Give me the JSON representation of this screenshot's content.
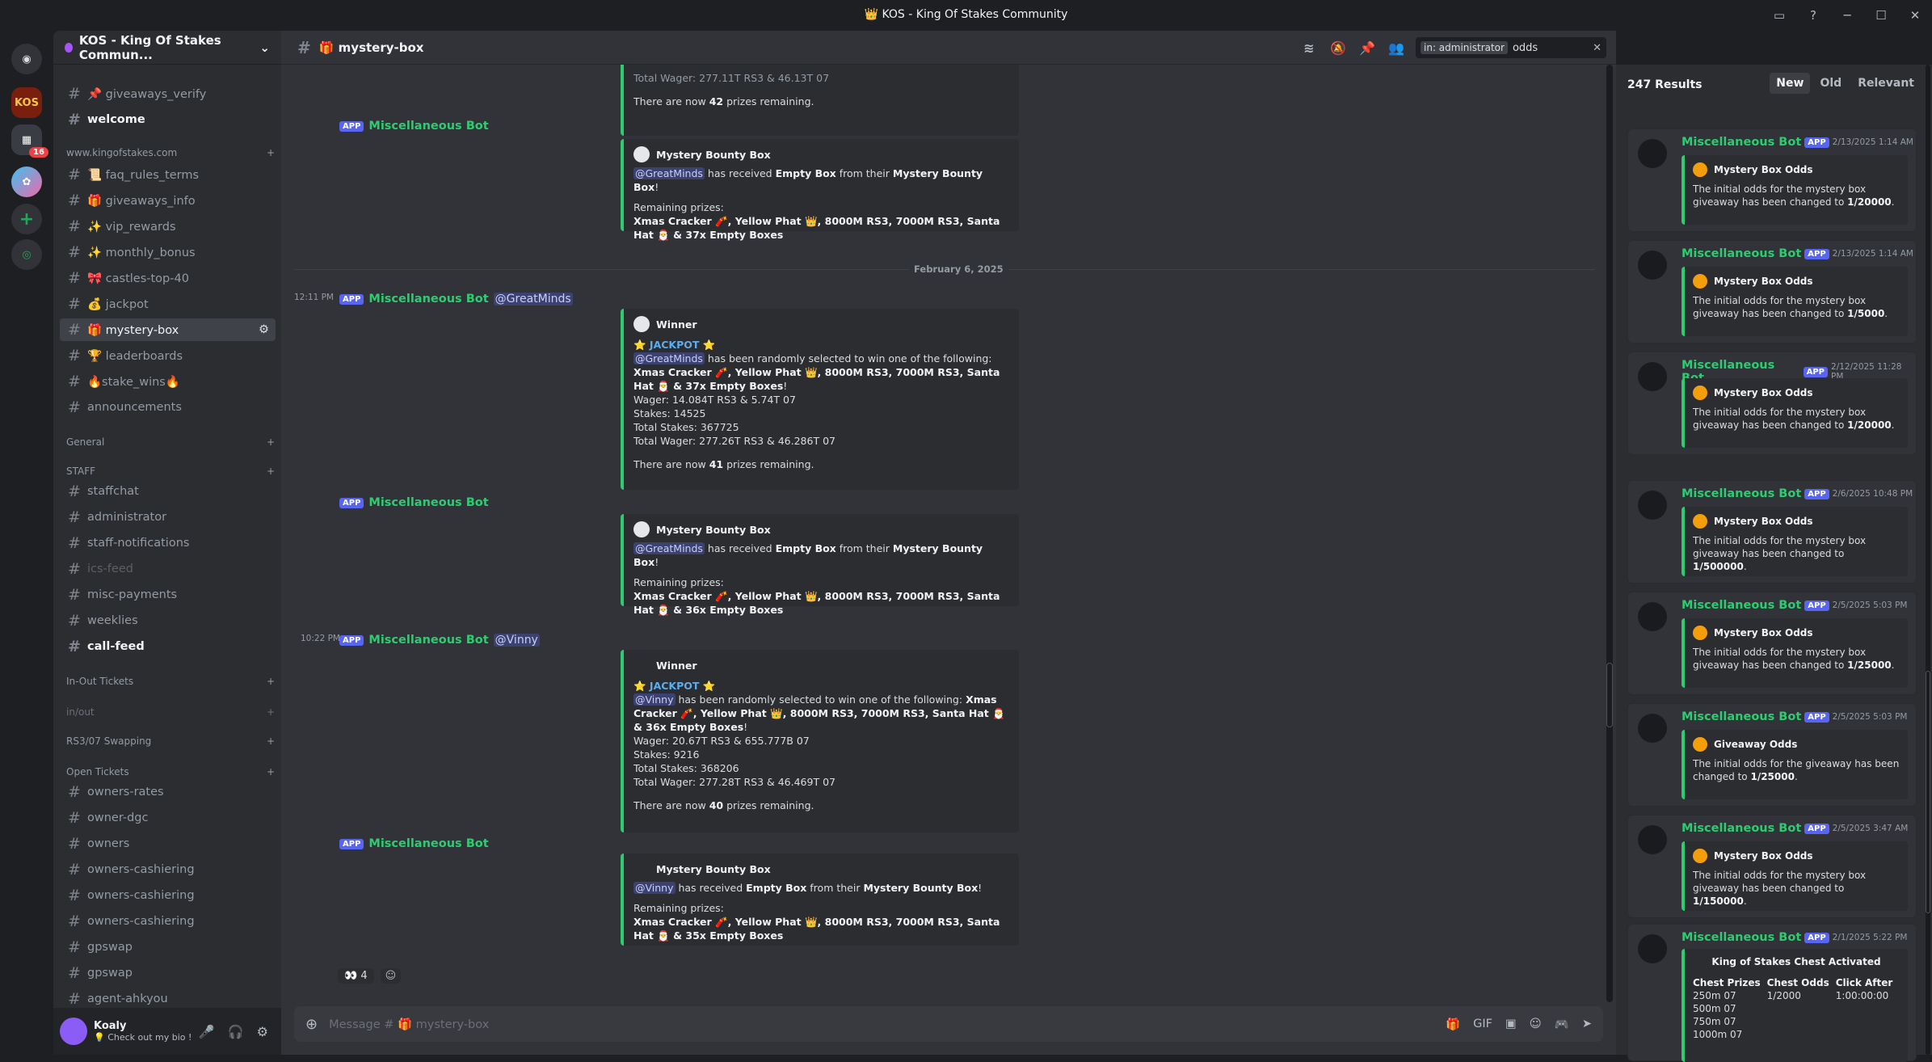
{
  "window": {
    "title": "KOS - King Of Stakes Community",
    "title_icon": "crown-emoji"
  },
  "servers": {
    "badge": "16"
  },
  "guild": {
    "name": "KOS - King Of Stakes Commun..."
  },
  "channels": [
    {
      "label": "📌 giveaways_verify",
      "state": "normal"
    },
    {
      "label": "welcome",
      "state": "unread"
    }
  ],
  "categories": {
    "site": "www.kingofstakes.com",
    "general": "General",
    "staff": "STAFF",
    "inout": "In-Out Tickets",
    "inout_channel": "in/out",
    "rs3": "RS3/07 Swapping",
    "open": "Open Tickets"
  },
  "site_channels": [
    "📜 faq_rules_terms",
    "🎁 giveaways_info",
    "✨ vip_rewards",
    "✨ monthly_bonus",
    "🎀 castles-top-40",
    "💰 jackpot",
    "🎁 mystery-box",
    "🏆 leaderboards",
    "🔥stake_wins🔥",
    "announcements"
  ],
  "staff_channels": [
    "staffchat",
    "administrator",
    "staff-notifications",
    "ics-feed",
    "misc-payments",
    "weeklies",
    "call-feed"
  ],
  "ticket_channels": [
    "owners-rates",
    "owner-dgc",
    "owners",
    "owners-cashiering",
    "owners-cashiering",
    "owners-cashiering",
    "gpswap",
    "gpswap",
    "agent-ahkyou"
  ],
  "user": {
    "name": "Koaly",
    "status": "💡 Check out my bio !"
  },
  "header": {
    "channel": "🎁 mystery-box",
    "search_filter": "in: administrator",
    "search_query": "odds"
  },
  "messages": {
    "top_partial": "Total Wager: 277.11T RS3 & 46.13T 07",
    "top_remaining_pre": "There are now ",
    "top_remaining_num": "42",
    "top_remaining_post": " prizes remaining.",
    "bot": "Miscellaneous Bot",
    "app": "APP",
    "bounty_title": "Mystery Bounty Box",
    "m1_mention": "@GreatMinds",
    "m1_text_a": " has received ",
    "m1_empty": "Empty Box",
    "m1_text_b": " from their ",
    "m1_box": "Mystery Bounty Box",
    "m1_excl": "!",
    "remaining_label": "Remaining prizes:",
    "m1_prizes": "Xmas Cracker 🧨, Yellow Phat 👑, 8000M RS3, 7000M RS3, Santa Hat 🎅 & 37x Empty Boxes",
    "date_divider": "February 6, 2025",
    "w1_time": "12:11 PM",
    "w1_mention": "@GreatMinds",
    "winner": "Winner",
    "jackpot": "⭐ JACKPOT ⭐",
    "w1_selected": " has been randomly selected to win one of the following: ",
    "w1_prizes": "Xmas Cracker 🧨, Yellow Phat 👑, 8000M RS3, 7000M RS3, Santa Hat 🎅 & 37x Empty Boxes",
    "w1_wager": "Wager: 14.084T RS3 & 5.74T 07",
    "w1_stakes": "Stakes: 14525",
    "w1_total_stakes": "Total Stakes: 367725",
    "w1_total_wager": "Total Wager: 277.26T RS3 & 46.286T 07",
    "w1_remaining": "41",
    "m2_prizes": "Xmas Cracker 🧨, Yellow Phat 👑, 8000M RS3, 7000M RS3, Santa Hat 🎅 & 36x Empty Boxes",
    "w2_time": "10:22 PM",
    "w2_mention": "@Vinny",
    "w2_prizes": "Xmas Cracker 🧨, Yellow Phat 👑, 8000M RS3, 7000M RS3, Santa Hat 🎅 & 36x Empty Boxes",
    "w2_wager": "Wager: 20.67T RS3 & 655.777B 07",
    "w2_stakes": "Stakes: 9216",
    "w2_total_stakes": "Total Stakes: 368206",
    "w2_total_wager": "Total Wager: 277.28T RS3 & 46.469T 07",
    "w2_remaining": "40",
    "m3_mention": "@Vinny",
    "m3_prizes": "Xmas Cracker 🧨, Yellow Phat 👑, 8000M RS3, 7000M RS3, Santa Hat 🎅 & 35x Empty Boxes",
    "reaction_emoji": "👀",
    "reaction_count": "4"
  },
  "composer": {
    "placeholder": "Message # 🎁 mystery-box"
  },
  "search": {
    "count": "247 Results",
    "tabs": [
      "New",
      "Old",
      "Relevant"
    ],
    "results": [
      {
        "time": "2/13/2025 1:14 AM",
        "title": "Mystery Box Odds",
        "text": "The initial odds for the mystery box giveaway has been changed to ",
        "odds": "1/20000"
      },
      {
        "time": "2/13/2025 1:14 AM",
        "title": "Mystery Box Odds",
        "text": "The initial odds for the mystery box giveaway has been changed to ",
        "odds": "1/5000"
      },
      {
        "time": "2/12/2025 11:28 PM",
        "title": "Mystery Box Odds",
        "text": "The initial odds for the mystery box giveaway has been changed to ",
        "odds": "1/20000"
      },
      {
        "time": "2/6/2025 10:48 PM",
        "title": "Mystery Box Odds",
        "text": "The initial odds for the mystery box giveaway has been changed to ",
        "odds": "1/500000"
      },
      {
        "time": "2/5/2025 5:03 PM",
        "title": "Mystery Box Odds",
        "text": "The initial odds for the mystery box giveaway has been changed to ",
        "odds": "1/25000"
      },
      {
        "time": "2/5/2025 5:03 PM",
        "title": "Giveaway Odds",
        "text": "The initial odds for the giveaway has been changed to ",
        "odds": "1/25000"
      },
      {
        "time": "2/5/2025 3:47 AM",
        "title": "Mystery Box Odds",
        "text": "The initial odds for the mystery box giveaway has been changed to ",
        "odds": "1/150000"
      }
    ],
    "last": {
      "time": "2/1/2025 5:22 PM",
      "title": "King of Stakes Chest Activated",
      "col1": "Chest Prizes",
      "col2": "Chest Odds",
      "col3": "Click After",
      "prizes": [
        "250m 07",
        "500m 07",
        "750m 07",
        "1000m 07"
      ],
      "odds": "1/2000",
      "click_after": "1:00:00:00"
    }
  },
  "colors": {
    "bot_green": "#2ecc71",
    "app_badge": "#5865f2",
    "mention": "#c9cdfb"
  }
}
